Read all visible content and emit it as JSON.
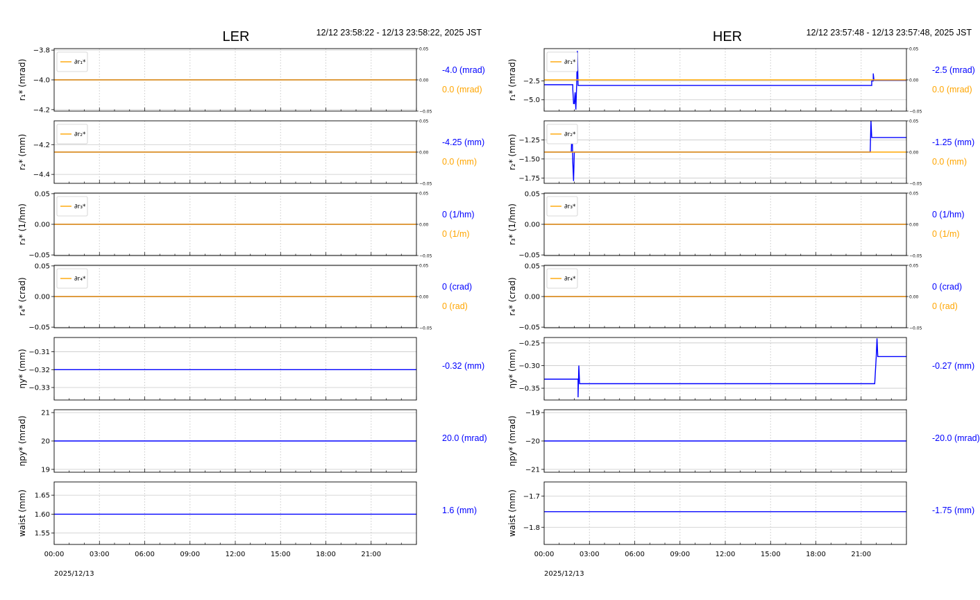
{
  "colors": {
    "blue": "#0000ff",
    "orange": "#ffa500",
    "grid": "#c8c8c8"
  },
  "chart_data": [
    {
      "type": "line",
      "title": "LER",
      "time_range": "12/12 23:58:22 - 12/13 23:58:22, 2025 JST",
      "date_label": "2025/12/13",
      "x_ticks": [
        "00:00",
        "03:00",
        "06:00",
        "09:00",
        "12:00",
        "15:00",
        "18:00",
        "21:00"
      ],
      "x_range_hours": [
        0,
        24
      ],
      "panels": [
        {
          "ylabel": "r₁* (mrad)",
          "ylim": [
            -4.21,
            -3.79
          ],
          "yticks": [
            -3.8,
            -4.0,
            -4.2
          ],
          "yticklabels": [
            "−3.8",
            "−4.0",
            "−4.2"
          ],
          "right_axis": {
            "ylim": [
              -0.05,
              0.05
            ],
            "ticks": [
              "0.05",
              "0.00",
              "−0.05"
            ]
          },
          "legend": "∂r₁*",
          "series": [
            {
              "color": "blue",
              "points": [
                [
                  0,
                  -4.0
                ],
                [
                  24,
                  -4.0
                ]
              ]
            },
            {
              "color": "orange",
              "axis": "right",
              "points": [
                [
                  0,
                  0.0
                ],
                [
                  24,
                  0.0
                ]
              ]
            }
          ],
          "value": "-4.0 (mrad)",
          "value2": "0.0 (mrad)"
        },
        {
          "ylabel": "r₂* (mm)",
          "ylim": [
            -4.46,
            -4.04
          ],
          "yticks": [
            -4.2,
            -4.4
          ],
          "yticklabels": [
            "−4.2",
            "−4.4"
          ],
          "right_axis": {
            "ylim": [
              -0.05,
              0.05
            ],
            "ticks": [
              "0.05",
              "0.00",
              "−0.05"
            ]
          },
          "legend": "∂r₂*",
          "series": [
            {
              "color": "blue",
              "points": [
                [
                  0,
                  -4.25
                ],
                [
                  24,
                  -4.25
                ]
              ]
            },
            {
              "color": "orange",
              "axis": "right",
              "points": [
                [
                  0,
                  0.0
                ],
                [
                  24,
                  0.0
                ]
              ]
            }
          ],
          "value": "-4.25 (mm)",
          "value2": "0.0 (mm)"
        },
        {
          "ylabel": "r₃* (1/hm)",
          "ylim": [
            -0.051,
            0.051
          ],
          "yticks": [
            0.05,
            0.0,
            -0.05
          ],
          "yticklabels": [
            "0.05",
            "0.00",
            "−0.05"
          ],
          "right_axis": {
            "ylim": [
              -0.05,
              0.05
            ],
            "ticks": [
              "0.05",
              "0.00",
              "−0.05"
            ]
          },
          "legend": "∂r₃*",
          "series": [
            {
              "color": "blue",
              "points": [
                [
                  0,
                  0
                ],
                [
                  24,
                  0
                ]
              ]
            },
            {
              "color": "orange",
              "axis": "right",
              "points": [
                [
                  0,
                  0.0
                ],
                [
                  24,
                  0.0
                ]
              ]
            }
          ],
          "value": "0 (1/hm)",
          "value2": "0 (1/m)"
        },
        {
          "ylabel": "r₄* (crad)",
          "ylim": [
            -0.051,
            0.051
          ],
          "yticks": [
            0.05,
            0.0,
            -0.05
          ],
          "yticklabels": [
            "0.05",
            "0.00",
            "−0.05"
          ],
          "right_axis": {
            "ylim": [
              -0.05,
              0.05
            ],
            "ticks": [
              "0.05",
              "0.00",
              "−0.05"
            ]
          },
          "legend": "∂r₄*",
          "series": [
            {
              "color": "blue",
              "points": [
                [
                  0,
                  0
                ],
                [
                  24,
                  0
                ]
              ]
            },
            {
              "color": "orange",
              "axis": "right",
              "points": [
                [
                  0,
                  0.0
                ],
                [
                  24,
                  0.0
                ]
              ]
            }
          ],
          "value": "0 (crad)",
          "value2": "0 (rad)"
        },
        {
          "ylabel": "ηy* (mm)",
          "ylim": [
            -0.337,
            -0.302
          ],
          "yticks": [
            -0.31,
            -0.32,
            -0.33
          ],
          "yticklabels": [
            "−0.31",
            "−0.32",
            "−0.33"
          ],
          "series": [
            {
              "color": "blue",
              "points": [
                [
                  0,
                  -0.32
                ],
                [
                  24,
                  -0.32
                ]
              ]
            }
          ],
          "value": "-0.32 (mm)"
        },
        {
          "ylabel": "ηpy* (mrad)",
          "ylim": [
            18.9,
            21.1
          ],
          "yticks": [
            21,
            20,
            19
          ],
          "yticklabels": [
            "21",
            "20",
            "19"
          ],
          "series": [
            {
              "color": "blue",
              "points": [
                [
                  0,
                  20.0
                ],
                [
                  24,
                  20.0
                ]
              ]
            }
          ],
          "value": "20.0 (mrad)"
        },
        {
          "ylabel": "waist (mm)",
          "ylim": [
            1.52,
            1.685
          ],
          "yticks": [
            1.65,
            1.6,
            1.55
          ],
          "yticklabels": [
            "1.65",
            "1.60",
            "1.55"
          ],
          "series": [
            {
              "color": "blue",
              "points": [
                [
                  0,
                  1.6
                ],
                [
                  24,
                  1.6
                ]
              ]
            }
          ],
          "value": "1.6 (mm)"
        }
      ]
    },
    {
      "type": "line",
      "title": "HER",
      "time_range": "12/12 23:57:48 - 12/13 23:57:48, 2025 JST",
      "date_label": "2025/12/13",
      "x_ticks": [
        "00:00",
        "03:00",
        "06:00",
        "09:00",
        "12:00",
        "15:00",
        "18:00",
        "21:00"
      ],
      "x_range_hours": [
        0,
        24
      ],
      "panels": [
        {
          "ylabel": "r₁* (mrad)",
          "ylim": [
            -6.5,
            1.8
          ],
          "yticks": [
            -2.5,
            -5.0
          ],
          "yticklabels": [
            "−2.5",
            "−5.0"
          ],
          "right_axis": {
            "ylim": [
              -0.05,
              0.05
            ],
            "ticks": [
              "0.05",
              "0.00",
              "−0.05"
            ]
          },
          "legend": "∂r₁*",
          "series": [
            {
              "color": "blue",
              "points": [
                [
                  0,
                  -3.0
                ],
                [
                  1.9,
                  -3.0
                ],
                [
                  1.9,
                  -3.6
                ],
                [
                  1.95,
                  -5.5
                ],
                [
                  2.0,
                  -5.5
                ],
                [
                  2.05,
                  -4.0
                ],
                [
                  2.1,
                  -6.3
                ],
                [
                  2.15,
                  -3.2
                ],
                [
                  2.2,
                  1.5
                ],
                [
                  2.25,
                  -3.1
                ],
                [
                  21.7,
                  -3.1
                ],
                [
                  21.7,
                  -2.5
                ],
                [
                  21.8,
                  -2.5
                ],
                [
                  21.8,
                  -1.5
                ],
                [
                  21.85,
                  -2.4
                ],
                [
                  24,
                  -2.4
                ]
              ]
            },
            {
              "color": "orange",
              "axis": "right",
              "points": [
                [
                  0,
                  0.0
                ],
                [
                  24,
                  0.0
                ]
              ]
            }
          ],
          "value": "-2.5 (mrad)",
          "value2": "0.0 (mrad)"
        },
        {
          "ylabel": "r₂* (mm)",
          "ylim": [
            -1.82,
            -1.0
          ],
          "yticks": [
            -1.25,
            -1.5,
            -1.75
          ],
          "yticklabels": [
            "−1.25",
            "−1.50",
            "−1.75"
          ],
          "right_axis": {
            "ylim": [
              -0.05,
              0.05
            ],
            "ticks": [
              "0.05",
              "0.00",
              "−0.05"
            ]
          },
          "legend": "∂r₂*",
          "series": [
            {
              "color": "blue",
              "points": [
                [
                  0,
                  -1.41
                ],
                [
                  1.8,
                  -1.41
                ],
                [
                  1.85,
                  -1.05
                ],
                [
                  1.9,
                  -1.55
                ],
                [
                  1.95,
                  -1.79
                ],
                [
                  2.0,
                  -1.41
                ],
                [
                  21.6,
                  -1.41
                ],
                [
                  21.65,
                  -1.0
                ],
                [
                  21.7,
                  -1.22
                ],
                [
                  24,
                  -1.22
                ]
              ]
            },
            {
              "color": "orange",
              "axis": "right",
              "points": [
                [
                  0,
                  0.0
                ],
                [
                  24,
                  0.0
                ]
              ]
            }
          ],
          "value": "-1.25 (mm)",
          "value2": "0.0 (mm)"
        },
        {
          "ylabel": "r₃* (1/hm)",
          "ylim": [
            -0.051,
            0.051
          ],
          "yticks": [
            0.05,
            0.0,
            -0.05
          ],
          "yticklabels": [
            "0.05",
            "0.00",
            "−0.05"
          ],
          "right_axis": {
            "ylim": [
              -0.05,
              0.05
            ],
            "ticks": [
              "0.05",
              "0.00",
              "−0.05"
            ]
          },
          "legend": "∂r₃*",
          "series": [
            {
              "color": "blue",
              "points": [
                [
                  0,
                  0
                ],
                [
                  24,
                  0
                ]
              ]
            },
            {
              "color": "orange",
              "axis": "right",
              "points": [
                [
                  0,
                  0.0
                ],
                [
                  24,
                  0.0
                ]
              ]
            }
          ],
          "value": "0 (1/hm)",
          "value2": "0 (1/m)"
        },
        {
          "ylabel": "r₄* (crad)",
          "ylim": [
            -0.051,
            0.051
          ],
          "yticks": [
            0.05,
            0.0,
            -0.05
          ],
          "yticklabels": [
            "0.05",
            "0.00",
            "−0.05"
          ],
          "right_axis": {
            "ylim": [
              -0.05,
              0.05
            ],
            "ticks": [
              "0.05",
              "0.00",
              "−0.05"
            ]
          },
          "legend": "∂r₄*",
          "series": [
            {
              "color": "blue",
              "points": [
                [
                  0,
                  0
                ],
                [
                  24,
                  0
                ]
              ]
            },
            {
              "color": "orange",
              "axis": "right",
              "points": [
                [
                  0,
                  0.0
                ],
                [
                  24,
                  0.0
                ]
              ]
            }
          ],
          "value": "0 (crad)",
          "value2": "0 (rad)"
        },
        {
          "ylabel": "ηy* (mm)",
          "ylim": [
            -0.376,
            -0.238
          ],
          "yticks": [
            -0.25,
            -0.3,
            -0.35
          ],
          "yticklabels": [
            "−0.25",
            "−0.30",
            "−0.35"
          ],
          "series": [
            {
              "color": "blue",
              "points": [
                [
                  0,
                  -0.33
                ],
                [
                  2.25,
                  -0.33
                ],
                [
                  2.25,
                  -0.37
                ],
                [
                  2.3,
                  -0.3
                ],
                [
                  2.35,
                  -0.34
                ],
                [
                  21.9,
                  -0.34
                ],
                [
                  22.0,
                  -0.28
                ],
                [
                  22.05,
                  -0.24
                ],
                [
                  22.1,
                  -0.28
                ],
                [
                  24,
                  -0.28
                ]
              ]
            }
          ],
          "value": "-0.27 (mm)"
        },
        {
          "ylabel": "ηpy* (mrad)",
          "ylim": [
            -21.1,
            -18.9
          ],
          "yticks": [
            -19,
            -20,
            -21
          ],
          "yticklabels": [
            "−19",
            "−20",
            "−21"
          ],
          "series": [
            {
              "color": "blue",
              "points": [
                [
                  0,
                  -20.0
                ],
                [
                  24,
                  -20.0
                ]
              ]
            }
          ],
          "value": "-20.0 (mrad)"
        },
        {
          "ylabel": "waist (mm)",
          "ylim": [
            -1.855,
            -1.655
          ],
          "yticks": [
            -1.7,
            -1.8
          ],
          "yticklabels": [
            "−1.7",
            "−1.8"
          ],
          "series": [
            {
              "color": "blue",
              "points": [
                [
                  0,
                  -1.75
                ],
                [
                  24,
                  -1.75
                ]
              ]
            }
          ],
          "value": "-1.75 (mm)"
        }
      ]
    }
  ]
}
